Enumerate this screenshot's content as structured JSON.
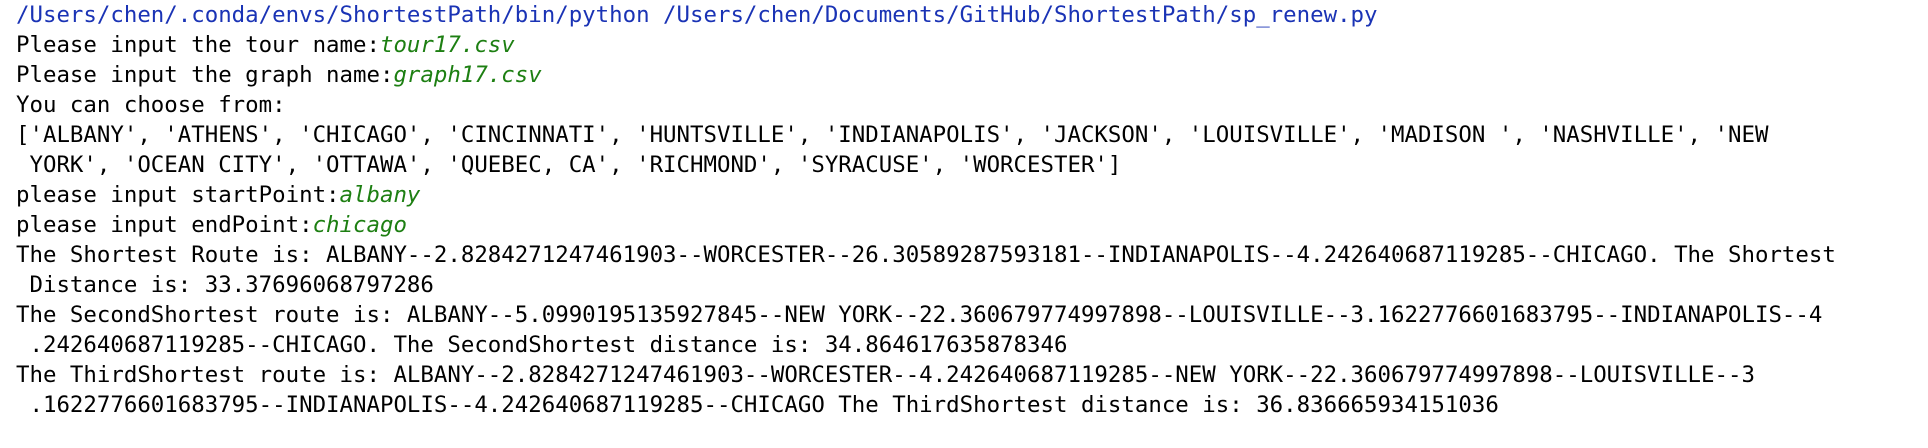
{
  "console": {
    "command_line": "/Users/chen/.conda/envs/ShortestPath/bin/python /Users/chen/Documents/GitHub/ShortestPath/sp_renew.py",
    "prompt_tour": "Please input the tour name:",
    "input_tour": "tour17.csv",
    "prompt_graph": "Please input the graph name:",
    "input_graph": "graph17.csv",
    "choose_from": "You can choose from:",
    "options_line1": "['ALBANY', 'ATHENS', 'CHICAGO', 'CINCINNATI', 'HUNTSVILLE', 'INDIANAPOLIS', 'JACKSON', 'LOUISVILLE', 'MADISON ', 'NASHVILLE', 'NEW",
    "options_line2": " YORK', 'OCEAN CITY', 'OTTAWA', 'QUEBEC, CA', 'RICHMOND', 'SYRACUSE', 'WORCESTER']",
    "prompt_start": "please input startPoint:",
    "input_start": "albany",
    "prompt_end": "please input endPoint:",
    "input_end": "chicago",
    "shortest_line1": "The Shortest Route is: ALBANY--2.8284271247461903--WORCESTER--26.30589287593181--INDIANAPOLIS--4.242640687119285--CHICAGO. The Shortest",
    "shortest_line2": " Distance is: 33.37696068797286",
    "second_line1": "The SecondShortest route is: ALBANY--5.0990195135927845--NEW YORK--22.360679774997898--LOUISVILLE--3.1622776601683795--INDIANAPOLIS--4",
    "second_line2": " .242640687119285--CHICAGO. The SecondShortest distance is: 34.864617635878346",
    "third_line1": "The ThirdShortest route is: ALBANY--2.8284271247461903--WORCESTER--4.242640687119285--NEW YORK--22.360679774997898--LOUISVILLE--3",
    "third_line2": " .1622776601683795--INDIANAPOLIS--4.242640687119285--CHICAGO The ThirdShortest distance is: 36.836665934151036"
  }
}
